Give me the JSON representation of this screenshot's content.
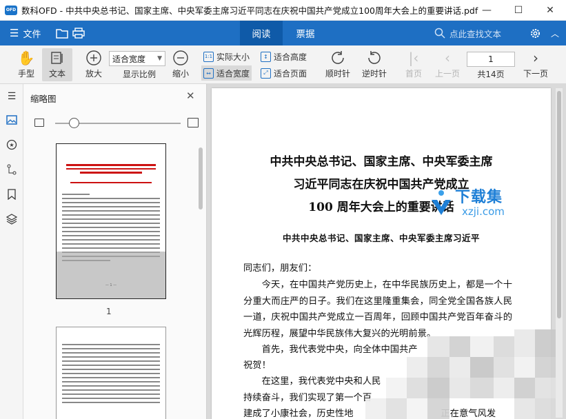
{
  "titlebar": {
    "logo": "OFD",
    "title": "数科OFD - 中共中央总书记、国家主席、中央军委主席习近平同志在庆祝中国共产党成立100周年大会上的重要讲话.pdf",
    "minimize": "—",
    "maximize": "☐",
    "close": "✕"
  },
  "menubar": {
    "file_label": "文件",
    "tabs": [
      {
        "label": "阅读",
        "active": true
      },
      {
        "label": "票据",
        "active": false
      }
    ],
    "search_placeholder": "点此查找文本"
  },
  "toolbar": {
    "hand": "手型",
    "text": "文本",
    "zoom_in": "放大",
    "zoom_select_value": "适合宽度",
    "display_ratio": "显示比例",
    "zoom_out": "缩小",
    "actual_size": "实际大小",
    "fit_height": "适合高度",
    "fit_width": "适合宽度",
    "fit_page": "适合页面",
    "rotate_cw": "顺时针",
    "rotate_ccw": "逆时针",
    "first_page": "首页",
    "prev_page": "上一页",
    "page_value": "1",
    "total_pages": "共14页",
    "next_page": "下一页",
    "actual_size_glyph": "1:1"
  },
  "thumbnails": {
    "header": "缩略图",
    "close": "✕",
    "page1_number": "1",
    "page1_footer": "— 1 —",
    "zoom_level": 0.15
  },
  "document": {
    "title_lines": [
      "中共中央总书记、国家主席、中央军委主席",
      "习近平同志在庆祝中国共产党成立",
      "100 周年大会上的重要讲话"
    ],
    "subtitle": "中共中央总书记、国家主席、中央军委主席习近平",
    "paragraphs": [
      "同志们，朋友们：",
      "今天，在中国共产党历史上，在中华民族历史上，都是一个十分重大而庄严的日子。我们在这里隆重集会，同全党全国各族人民一道，庆祝中国共产党成立一百周年，回顾中国共产党百年奋斗的光辉历程，展望中华民族伟大复兴的光明前景。",
      "首先，我代表党中央，向全体中国共产",
      "祝贺！",
      "在这里，我代表党中央和人民",
      "持续奋斗，我们实现了第一个百",
      "建成了小康社会，历史性地                              正在意气风发"
    ]
  },
  "watermark": {
    "cn": "下载集",
    "en": "xzji.com"
  },
  "colors": {
    "brand_blue": "#1e6fc3",
    "active_tab": "#0f5aa8",
    "toolbar_bg": "#f3f3f3",
    "doc_bg": "#dadada"
  }
}
